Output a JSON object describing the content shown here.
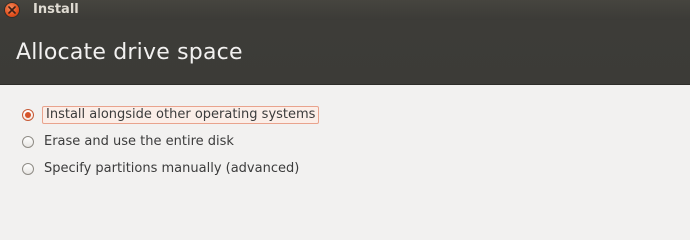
{
  "window": {
    "title": "Install",
    "close_icon": "close-icon"
  },
  "header": {
    "title": "Allocate drive space"
  },
  "options": [
    {
      "label": "Install alongside other operating systems",
      "selected": true
    },
    {
      "label": "Erase and use the entire disk",
      "selected": false
    },
    {
      "label": "Specify partitions manually (advanced)",
      "selected": false
    }
  ],
  "colors": {
    "accent": "#d6542a",
    "titlebar": "#3c3b37",
    "background": "#f2f1f0"
  }
}
